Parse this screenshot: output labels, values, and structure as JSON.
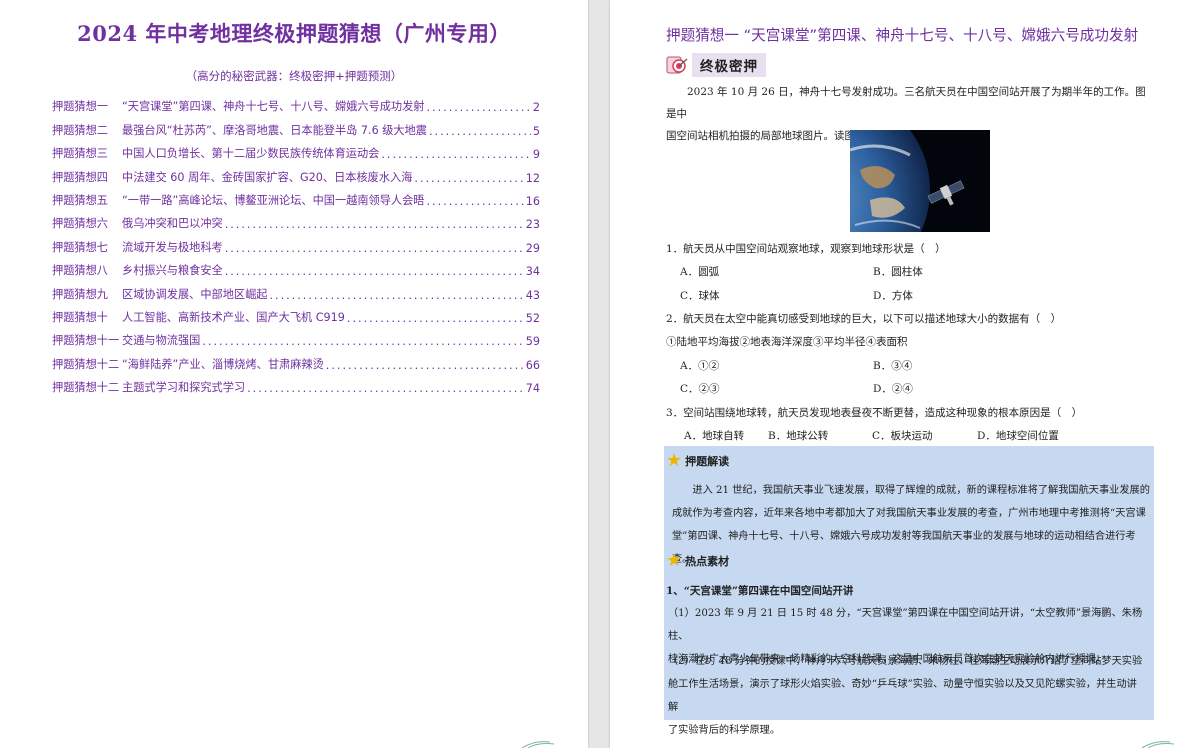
{
  "left_page": {
    "title": "2024 年中考地理终极押题猜想（广州专用）",
    "toc_subtitle": "（高分的秘密武器：终极密押+押题预测）",
    "toc": [
      {
        "label": "押题猜想一",
        "text": "“天宫课堂”第四课、神舟十七号、十八号、嫦娥六号成功发射",
        "page": "2"
      },
      {
        "label": "押题猜想二",
        "text": "最强台风“杜苏芮”、摩洛哥地震、日本能登半岛 7.6 级大地震",
        "page": "5"
      },
      {
        "label": "押题猜想三",
        "text": "中国人口负增长、第十二届少数民族传统体育运动会",
        "page": "9"
      },
      {
        "label": "押题猜想四",
        "text": "中法建交 60 周年、金砖国家扩容、G20、日本核废水入海",
        "page": "12"
      },
      {
        "label": "押题猜想五",
        "text": "“一带一路”高峰论坛、博鳌亚洲论坛、中国一越南领导人会晤",
        "page": "16"
      },
      {
        "label": "押题猜想六",
        "text": "俄乌冲突和巴以冲突",
        "page": "23"
      },
      {
        "label": "押题猜想七",
        "text": "流域开发与极地科考",
        "page": "29"
      },
      {
        "label": "押题猜想八",
        "text": "乡村振兴与粮食安全",
        "page": "34"
      },
      {
        "label": "押题猜想九",
        "text": "区域协调发展、中部地区崛起",
        "page": "43"
      },
      {
        "label": "押题猜想十",
        "text": "人工智能、高新技术产业、国产大飞机 C919",
        "page": "52"
      },
      {
        "label": "押题猜想十一",
        "text": "交通与物流强国",
        "page": "59"
      },
      {
        "label": "押题猜想十二",
        "text": "“海鲜陆养”产业、淄博烧烤、甘肃麻辣烫",
        "page": "66"
      },
      {
        "label": "押题猜想十二",
        "text": "主题式学习和探究式学习",
        "page": "74"
      }
    ]
  },
  "right_page": {
    "section_title": "押题猜想一 “天宫课堂”第四课、神舟十七号、十八号、嫦娥六号成功发射",
    "badge": "终极密押",
    "intro_line1": "2023 年 10 月 26 日，神舟十七号发射成功。三名航天员在中国空间站开展了为期半年的工作。图是中",
    "intro_line2": "国空间站相机拍摄的局部地球图片。读图，完成下面小题。",
    "q1": {
      "stem": "1．航天员从中国空间站观察地球，观察到地球形状是（　）",
      "options": [
        "A．圆弧",
        "B．圆柱体",
        "C．球体",
        "D．方体"
      ]
    },
    "q2": {
      "stem": "2．航天员在太空中能真切感受到地球的巨大，以下可以描述地球大小的数据有（　）",
      "sub": "①陆地平均海拔②地表海洋深度③平均半径④表面积",
      "options": [
        "A．①②",
        "B．③④",
        "C．②③",
        "D．②④"
      ]
    },
    "q3": {
      "stem": "3．空间站围绕地球转，航天员发现地表昼夜不断更替，造成这种现象的根本原因是（　）",
      "options": [
        "A．地球自转",
        "B．地球公转",
        "C．板块运动",
        "D．地球空间位置"
      ]
    },
    "analysis": {
      "heading": "押题解读",
      "line1": "进入 21 世纪，我国航天事业飞速发展，取得了辉煌的成就，新的课程标准将了解我国航天事业发展的",
      "line2": "成就作为考查内容，近年来各地中考都加大了对我国航天事业发展的考查，广州市地理中考推测将“天宫课",
      "line3": "堂”第四课、神舟十七号、十八号、嫦娥六号成功发射等我国航天事业的发展与地球的运动相结合进行考查。"
    },
    "hot": {
      "heading": "热点素材",
      "sub": "1、“天宫课堂”第四课在中国空间站开讲",
      "p1_line1": "（1）2023 年 9 月 21 日 15 时 48 分，“天宫课堂”第四课在中国空间站开讲，“太空教师”景海鹏、朱杨柱、",
      "p1_line2": "桂海潮为广大青少年带来一场精彩的太空科普课，这是中国航天员首次在梦天实验舱内进行授课。",
      "p2_line1": "（2）在约 48 分钟的授课中，神舟十六号航天员景海鹏、朱杨柱、桂海潮生动展示介绍了空间站梦天实验",
      "p2_line2": "舱工作生活场景，演示了球形火焰实验、奇妙“乒乓球”实验、动量守恒实验以及又见陀螺实验，并生动讲解",
      "p2_line3": "了实验背后的科学原理。"
    }
  },
  "colors": {
    "accent_purple": "#7030a0",
    "box_blue": "#c6d9f0",
    "star_gold": "#f0b400"
  }
}
